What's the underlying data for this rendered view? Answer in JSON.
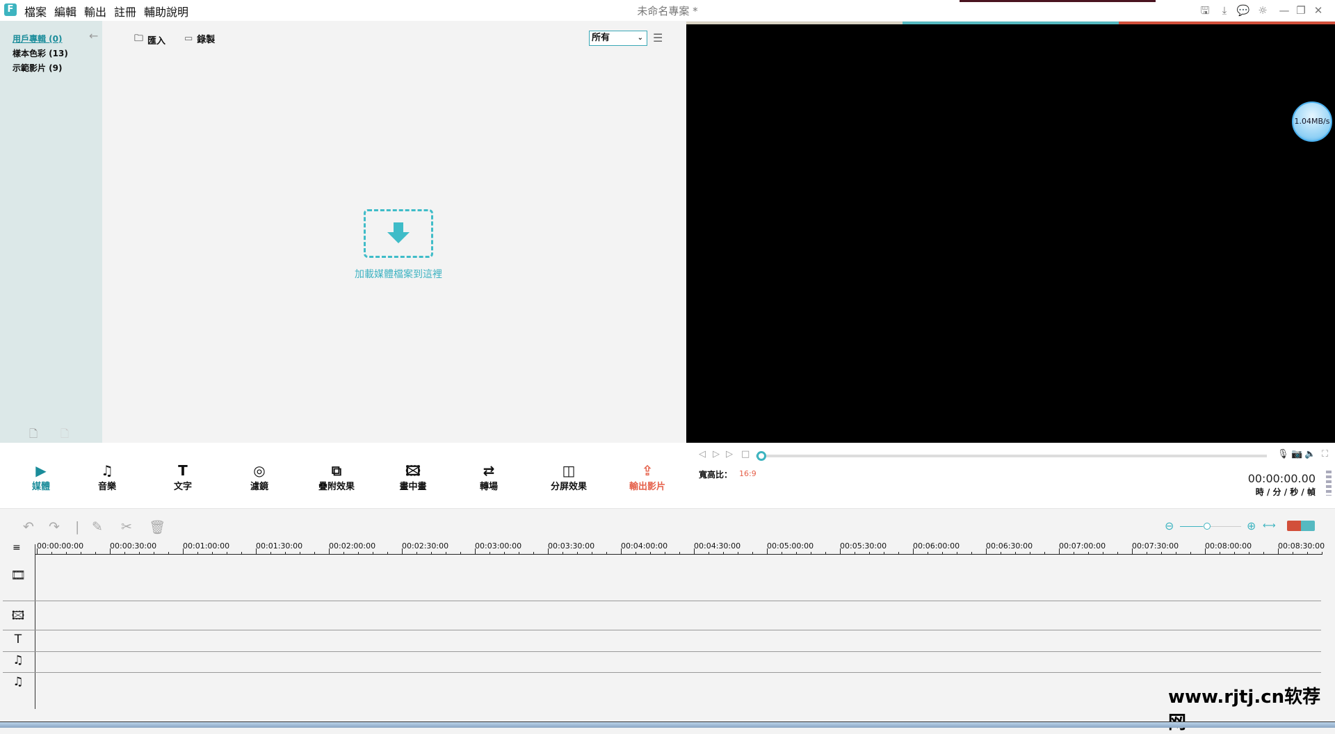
{
  "app": {
    "logo": "F",
    "title": "未命名專案 *"
  },
  "menu": [
    "檔案",
    "編輯",
    "輸出",
    "註冊",
    "輔助說明"
  ],
  "window_icons": [
    "save-icon",
    "download-icon",
    "feedback-icon",
    "theme-icon",
    "minimize-icon",
    "restore-icon",
    "close-icon"
  ],
  "sidebar": {
    "items": [
      {
        "label": "用戶專輯 (0)",
        "active": true
      },
      {
        "label": "樣本色彩 (13)"
      },
      {
        "label": "示範影片 (9)"
      }
    ]
  },
  "media": {
    "import_label": "匯入",
    "record_label": "錄製",
    "filter_value": "所有",
    "drop_text": "加載媒體檔案到這裡"
  },
  "overlay": {
    "speed": "1.04MB/s"
  },
  "tabs": [
    {
      "label": "媒體",
      "active": true
    },
    {
      "label": "音樂"
    },
    {
      "label": "文字"
    },
    {
      "label": "濾鏡"
    },
    {
      "label": "疊附效果"
    },
    {
      "label": "畫中畫"
    },
    {
      "label": "轉場"
    },
    {
      "label": "分屏效果"
    },
    {
      "label": "輸出影片",
      "accent": true
    }
  ],
  "player": {
    "aspect_label": "寬高比：",
    "aspect_value": "16:9",
    "timecode": "00:00:00.00",
    "timecode_units": "時 / 分 / 秒 / 幀",
    "progress": 0
  },
  "timeline": {
    "zoom_level": 0.4,
    "ruler": [
      "00:00:00:00",
      "00:00:30:00",
      "00:01:00:00",
      "00:01:30:00",
      "00:02:00:00",
      "00:02:30:00",
      "00:03:00:00",
      "00:03:30:00",
      "00:04:00:00",
      "00:04:30:00",
      "00:05:00:00",
      "00:05:30:00",
      "00:06:00:00",
      "00:06:30:00",
      "00:07:00:00",
      "00:07:30:00",
      "00:08:00:00",
      "00:08:30:00"
    ]
  },
  "watermark": "www.rjtj.cn软荐网",
  "colors": {
    "accent": "#3db4c0",
    "export": "#e5604a",
    "stripe_beige": "#d9d3c3",
    "stripe_teal": "#55b9c1",
    "stripe_red": "#d24f3a"
  }
}
